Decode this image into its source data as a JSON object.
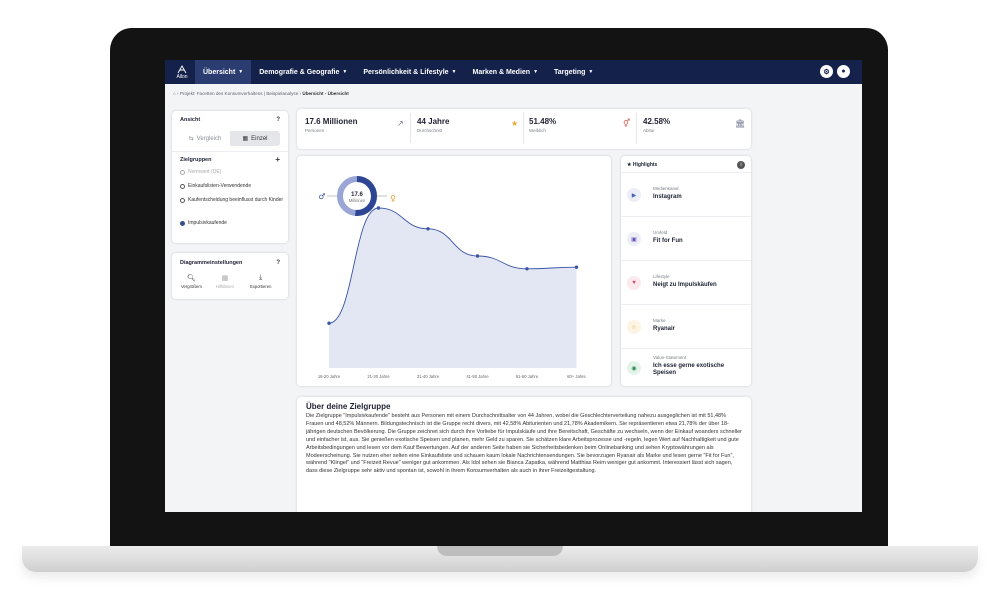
{
  "nav": {
    "logo_text": "Allon",
    "items": [
      {
        "label": "Übersicht"
      },
      {
        "label": "Demografie & Geografie"
      },
      {
        "label": "Persönlichkeit & Lifestyle"
      },
      {
        "label": "Marken & Medien"
      },
      {
        "label": "Targeting"
      }
    ],
    "icons": [
      "settings-icon",
      "user-icon"
    ]
  },
  "breadcrumb": {
    "project": "Projekt: Facetten des Konsumverhaltens | Beispielanalyse",
    "current": "Übersicht - Übersicht"
  },
  "ansicht": {
    "title": "Ansicht",
    "help": "?",
    "options": [
      {
        "label": "Vergleich"
      },
      {
        "label": "Einzel"
      }
    ]
  },
  "zielgruppen": {
    "title": "Zielgruppen",
    "add": "+",
    "items": [
      {
        "label": "Normwert (DE)"
      },
      {
        "label": "Einkaufslisten-Verwendende"
      },
      {
        "label": "Kaufentscheidung beeinflusst durch Kinder"
      },
      {
        "label": "Impulsivkaufende"
      }
    ]
  },
  "diagramm": {
    "title": "Diagrammeinstellungen",
    "help": "?",
    "tools": [
      {
        "label": "Vergrößern"
      },
      {
        "label": "Hilfslinien"
      },
      {
        "label": "Exportieren"
      }
    ]
  },
  "stats": [
    {
      "value": "17.6 Millionen",
      "label": "Personen",
      "icon": "trend-icon"
    },
    {
      "value": "44 Jahre",
      "label": "Durchschnitt",
      "icon": "star-icon"
    },
    {
      "value": "51.48%",
      "label": "Weiblich",
      "icon": "gender-icon"
    },
    {
      "value": "42.58%",
      "label": "Abitur",
      "icon": "bank-icon"
    }
  ],
  "donut": {
    "value": "17.6",
    "unit": "Millionen",
    "male": "♂",
    "female": "♀",
    "female_share": 0.5148
  },
  "chart_data": {
    "type": "area",
    "categories": [
      "18-20 Jahre",
      "21-30 Jahre",
      "31-40 Jahre",
      "41-50 Jahre",
      "51-60 Jahre",
      "60+ Jahre"
    ],
    "values": [
      0.28,
      1.0,
      0.87,
      0.7,
      0.62,
      0.63
    ],
    "color": "#3a54a5",
    "fill": "#e3e7f4"
  },
  "highlights": {
    "title": "Highlights",
    "items": [
      {
        "category": "Medienkanal",
        "value": "Instagram",
        "icon": "play-icon"
      },
      {
        "category": "Umfeld",
        "value": "Fit for Fun",
        "icon": "image-icon"
      },
      {
        "category": "Lifestyle",
        "value": "Neigt zu Impulskäufen",
        "icon": "heart-icon"
      },
      {
        "category": "Marke",
        "value": "Ryanair",
        "icon": "star-icon"
      },
      {
        "category": "Value-Statement",
        "value": "Ich esse gerne exotische Speisen",
        "icon": "chat-icon"
      }
    ]
  },
  "about": {
    "title": "Über deine Zielgruppe",
    "text": "Die Zielgruppe \"Impulsivkaufende\" besteht aus Personen mit einem Durchschnittsalter von 44 Jahren, wobei die Geschlechterverteilung nahezu ausgeglichen ist mit 51,48% Frauen und 48,52% Männern. Bildungstechnisch ist die Gruppe recht divers, mit 42,58% Abiturienten und 21,78% Akademikern. Sie repräsentieren etwa 21,78% der über 18-jährigen deutschen Bevölkerung. Die Gruppe zeichnet sich durch ihre Vorliebe für Impulskäufe und ihre Bereitschaft, Geschäfte zu wechseln, wenn der Einkauf woanders schneller und einfacher ist, aus. Sie genießen exotische Speisen und planen, mehr Geld zu sparen. Sie schätzen klare Arbeitsprozesse und -regeln, legen Wert auf Nachhaltigkeit und gute Arbeitsbedingungen und lesen vor dem Kauf Bewertungen. Auf der anderen Seite haben sie Sicherheitsbedenken beim Onlinebanking und sehen Kryptowährungen als Modeerscheinung. Sie nutzen eher selten eine Einkaufsliste und schauen kaum lokale Nachrichtensendungen. Sie bevorzugen Ryanair als Marke und lesen gerne \"Fit for Fun\", während \"Klingel\" und \"Freizeit Revue\" weniger gut ankommen. Als Idol sehen sie Bianca Zapatka, während Matthias Reim weniger gut ankommt. Interessiert lässt sich sagen, dass diese Zielgruppe sehr aktiv und spontan ist, sowohl in ihrem Konsumverhalten als auch in ihrer Freizeitgestaltung."
  }
}
